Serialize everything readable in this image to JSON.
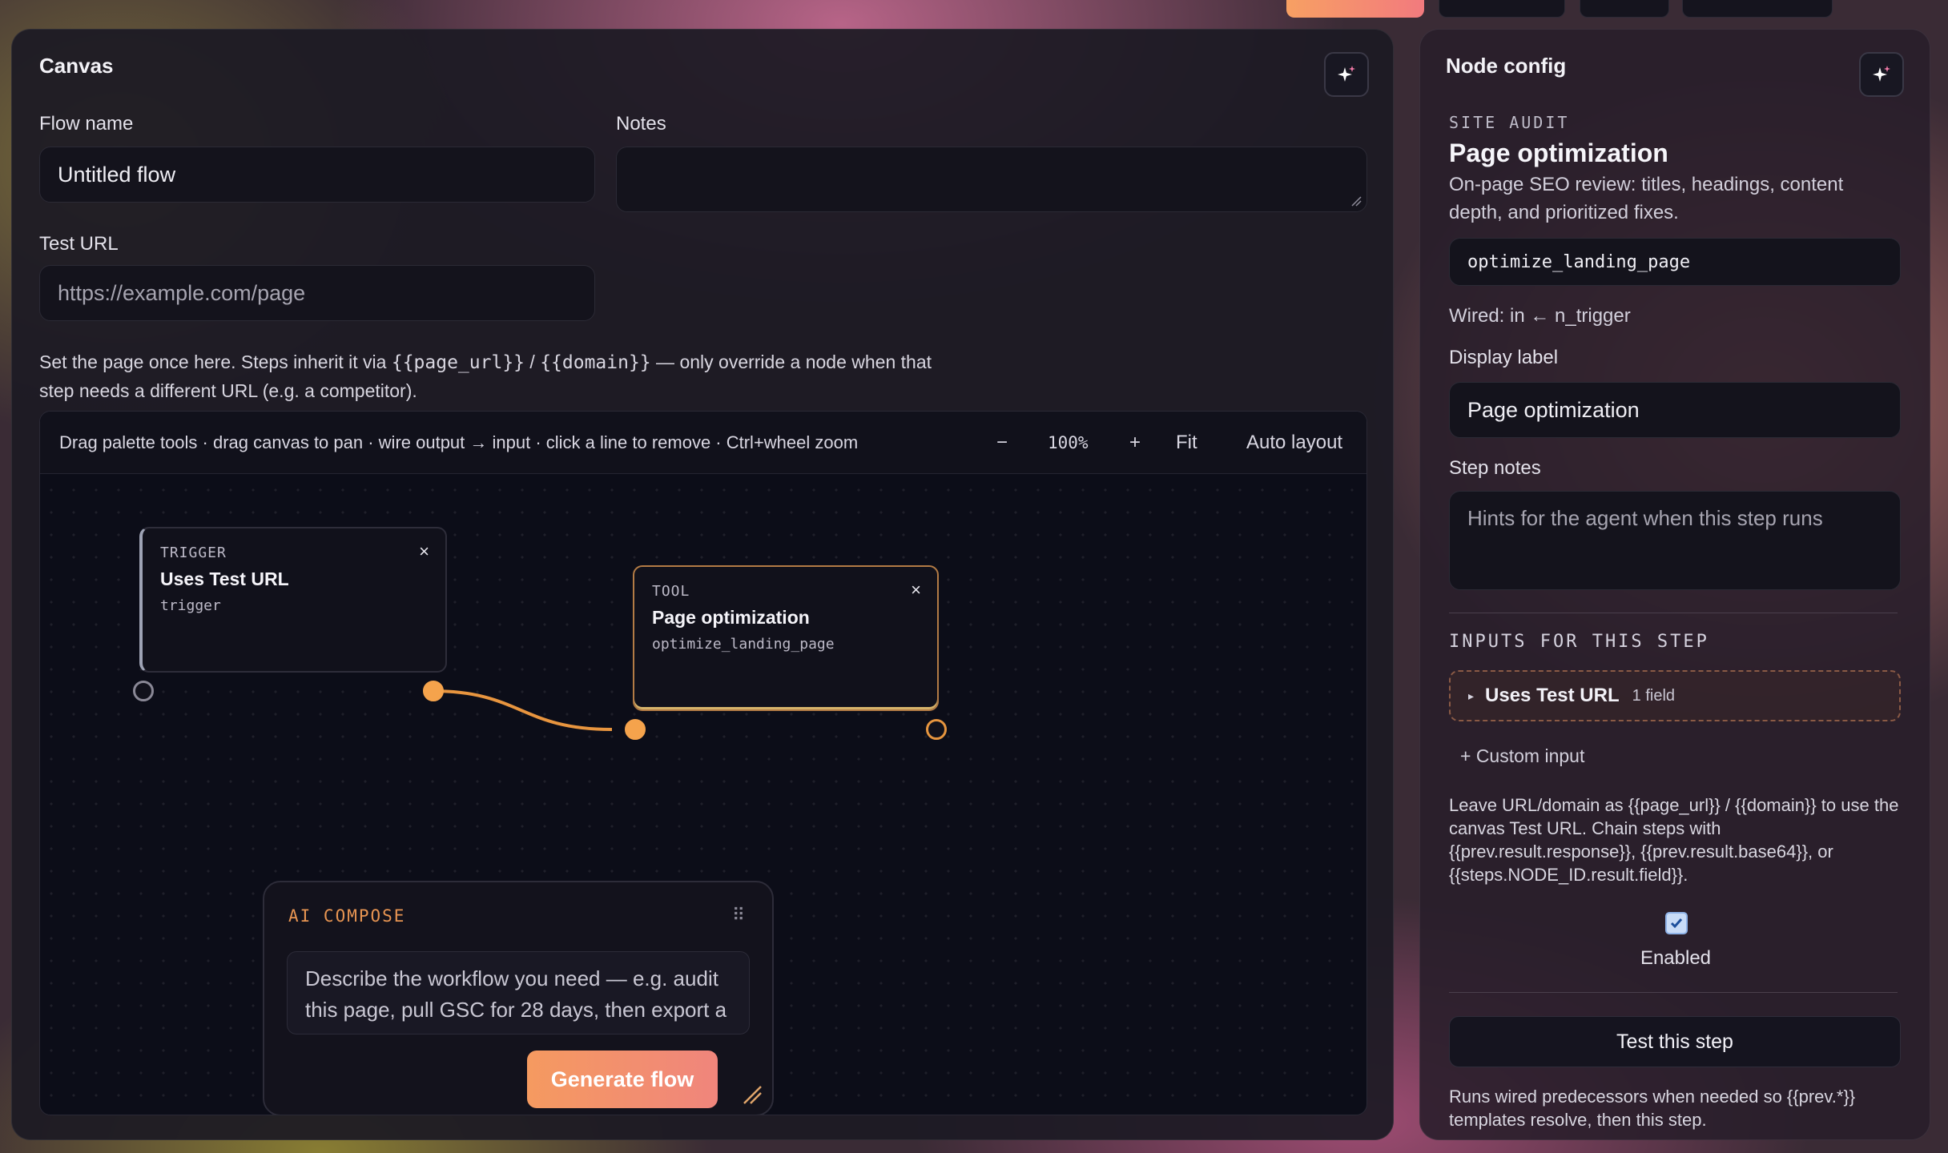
{
  "canvas": {
    "title": "Canvas",
    "flow_name_label": "Flow name",
    "flow_name_value": "Untitled flow",
    "notes_label": "Notes",
    "notes_value": "",
    "test_url_label": "Test URL",
    "test_url_placeholder": "https://example.com/page",
    "help_prefix": "Set the page once here. Steps inherit it via ",
    "help_code1": "{{page_url}}",
    "help_sep": " / ",
    "help_code2": "{{domain}}",
    "help_suffix_line1": " — only override a node when that",
    "help_line2": "step needs a different URL (e.g. a competitor).",
    "toolbar_hint": "Drag palette tools · drag canvas to pan · wire output → input · click a line to remove · Ctrl+wheel zoom",
    "zoom_out": "−",
    "zoom_level": "100%",
    "zoom_in": "+",
    "fit": "Fit",
    "auto_layout": "Auto layout"
  },
  "nodes": [
    {
      "kind": "TRIGGER",
      "title": "Uses Test URL",
      "sub": "trigger",
      "close": "×"
    },
    {
      "kind": "TOOL",
      "title": "Page optimization",
      "sub": "optimize_landing_page",
      "close": "×"
    }
  ],
  "compose": {
    "title": "AI COMPOSE",
    "drag": "⠿",
    "placeholder": "Describe the workflow you need — e.g. audit this page, pull GSC for 28 days, then export a",
    "generate": "Generate flow"
  },
  "config": {
    "title": "Node config",
    "eyebrow": "SITE AUDIT",
    "node_title": "Page optimization",
    "node_desc": "On-page SEO review: titles, headings, content depth, and prioritized fixes.",
    "tool_id": "optimize_landing_page",
    "wired": "Wired: in ← n_trigger",
    "display_label_label": "Display label",
    "display_label_value": "Page optimization",
    "step_notes_label": "Step notes",
    "step_notes_placeholder": "Hints for the agent when this step runs",
    "inputs_heading": "INPUTS FOR THIS STEP",
    "input_group_arrow": "▸",
    "input_group_name": "Uses Test URL",
    "input_group_count": "1 field",
    "custom_input": "+ Custom input",
    "inputs_help": "Leave URL/domain as {{page_url}} / {{domain}} to use the canvas Test URL. Chain steps with {{prev.result.response}}, {{prev.result.base64}}, or {{steps.NODE_ID.result.field}}.",
    "enabled_label": "Enabled",
    "test_button": "Test this step",
    "test_help": "Runs wired predecessors when needed so {{prev.*}} templates resolve, then this step."
  },
  "colors": {
    "accent_orange": "#f5a34c",
    "panel_bg": "#1c1a24",
    "canvas_bg": "#0c0d18"
  }
}
